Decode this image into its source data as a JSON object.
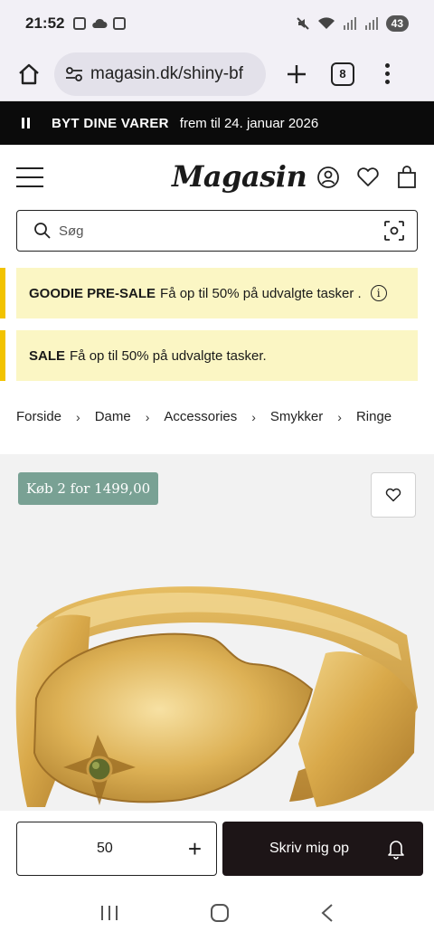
{
  "status_bar": {
    "time": "21:52",
    "battery": "43"
  },
  "browser": {
    "url": "magasin.dk/shiny-bf",
    "tab_count": "8"
  },
  "promo_strip": {
    "title": "BYT DINE VARER",
    "text": "frem til 24. januar 2026"
  },
  "header": {
    "logo": "Magasin"
  },
  "search": {
    "placeholder": "Søg"
  },
  "banners": [
    {
      "strong": "GOODIE PRE-SALE",
      "text": "Få op til 50% på udvalgte tasker ."
    },
    {
      "strong": "SALE",
      "text": "Få op til 50% på udvalgte tasker."
    }
  ],
  "breadcrumb": {
    "items": [
      "Forside",
      "Dame",
      "Accessories",
      "Smykker",
      "Ringe"
    ],
    "separator": "›"
  },
  "product": {
    "offer_badge": "Køb 2 for 1499,00"
  },
  "action_bar": {
    "size_value": "50",
    "size_plus": "+",
    "notify_label": "Skriv mig op"
  },
  "colors": {
    "promo_strip_bg": "#0b0b0b",
    "banner_bg": "#fbf6c4",
    "banner_accent": "#f2c300",
    "offer_badge_bg": "#79a194",
    "notify_button_bg": "#1d1517"
  }
}
